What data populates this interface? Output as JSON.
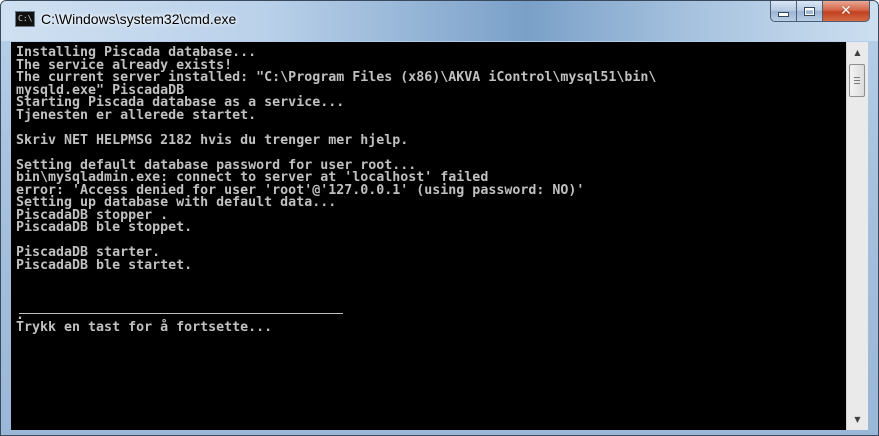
{
  "window": {
    "title": "C:\\Windows\\system32\\cmd.exe",
    "icon": "cmd-icon",
    "icon_text": "C:\\",
    "controls": {
      "minimize_icon": "minimize-icon",
      "maximize_icon": "maximize-icon",
      "close_icon": "close-icon",
      "close_glyph": "✕"
    }
  },
  "console": {
    "lines": [
      "Installing Piscada database...",
      "The service already exists!",
      "The current server installed: \"C:\\Program Files (x86)\\AKVA iControl\\mysql51\\bin\\",
      "mysqld.exe\" PiscadaDB",
      "Starting Piscada database as a service...",
      "Tjenesten er allerede startet.",
      "",
      "Skriv NET HELPMSG 2182 hvis du trenger mer hjelp.",
      "",
      "Setting default database password for user root...",
      "bin\\mysqladmin.exe: connect to server at 'localhost' failed",
      "error: 'Access denied for user 'root'@'127.0.0.1' (using password: NO)'",
      "Setting up database with default data...",
      "PiscadaDB stopper .",
      "PiscadaDB ble stoppet.",
      "",
      "PiscadaDB starter.",
      "PiscadaDB ble startet.",
      "",
      "",
      "",
      ".",
      "Trykk en tast for å fortsette..."
    ],
    "colors": {
      "background": "#000000",
      "foreground": "#c0c0c0"
    }
  },
  "scrollbar": {
    "up_arrow": "▲",
    "down_arrow": "▼",
    "up_icon": "scroll-up-arrow-icon",
    "down_icon": "scroll-down-arrow-icon"
  }
}
